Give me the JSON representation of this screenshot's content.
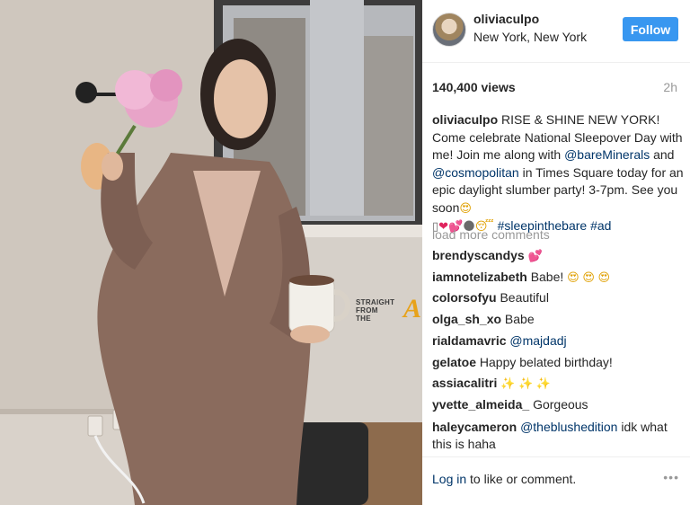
{
  "post": {
    "username": "oliviaculpo",
    "location": "New York, New York",
    "follow_label": "Follow",
    "views": "140,400 views",
    "time": "2h",
    "caption": {
      "author": "oliviaculpo",
      "t1": " RISE & SHINE NEW YORK! Come celebrate National Sleepover Day with me! Join me along with ",
      "m1": "@bareMinerals",
      "t2": " and ",
      "m2": "@cosmopolitan",
      "t3": " in Times Square today for an epic daylight slumber party! 3-7pm. See you soon",
      "e1": "😍",
      "e2": "▯",
      "e3": "❤",
      "e4": "💕",
      "e5": "🌑",
      "e6": "😴",
      "h1": "#sleepinthebare",
      "h2": "#ad"
    },
    "load_more": "load more comments",
    "comments": [
      {
        "user": "brendyscandys",
        "text": "",
        "emoji": "💕"
      },
      {
        "user": "iamnotelizabeth",
        "text": "Babe!",
        "emoji": "😍 😍 😍"
      },
      {
        "user": "colorsofyu",
        "text": "Beautiful"
      },
      {
        "user": "olga_sh_xo",
        "text": "Babe"
      },
      {
        "user": "rialdamavric",
        "mention": "@majdadj"
      },
      {
        "user": "gelatoe",
        "text": "Happy belated birthday!"
      },
      {
        "user": "assiacalitri",
        "text": "",
        "emoji": "✨ ✨ ✨"
      },
      {
        "user": "yvette_almeida_",
        "text": "Gorgeous"
      },
      {
        "user": "haleycameron",
        "mention": "@theblushedition",
        "text": "idk what this is haha"
      }
    ],
    "login_link": "Log in",
    "login_rest": " to like or comment.",
    "more_icon": "•••",
    "watermark": {
      "line1": "STRAIGHT",
      "line2": "FROM",
      "line3": "THE",
      "a": "A"
    },
    "colors": {
      "follow_bg": "#3897f0",
      "link": "#003569",
      "muted": "#999999"
    }
  }
}
